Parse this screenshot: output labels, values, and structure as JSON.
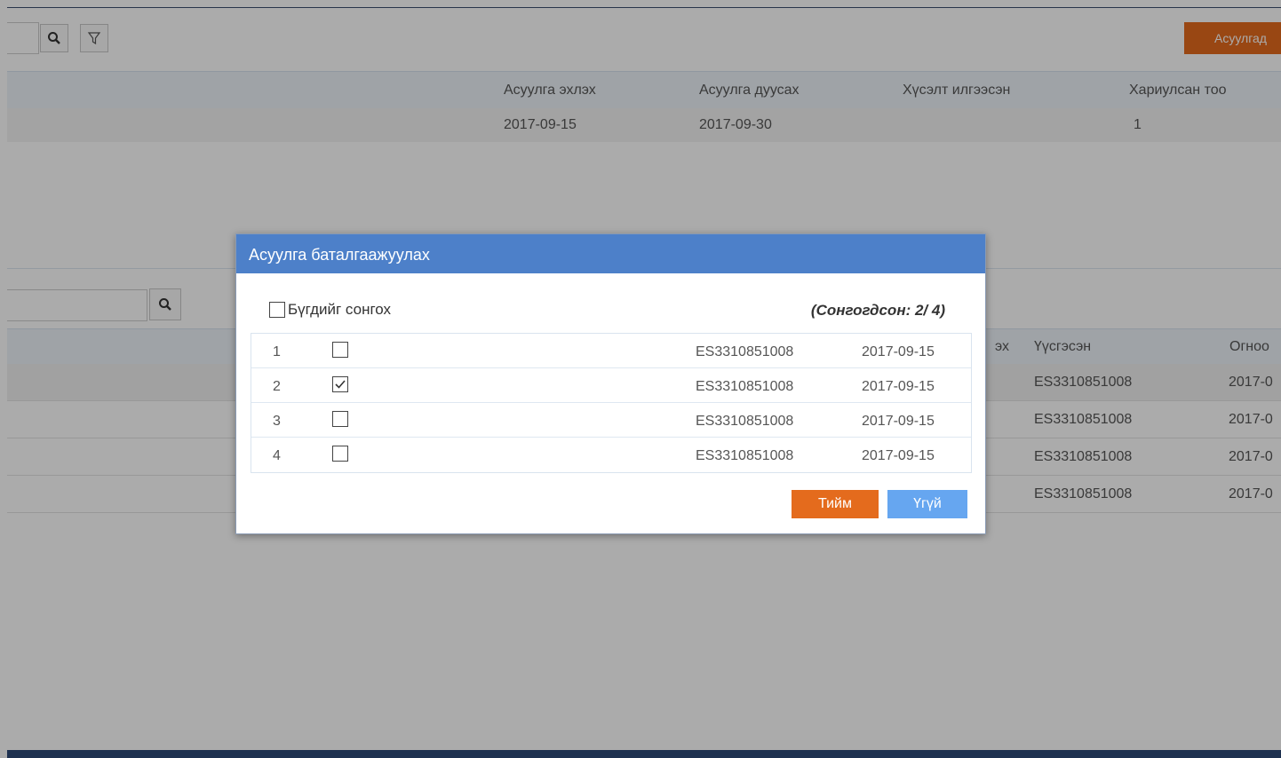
{
  "toolbar": {
    "action_button_label": "Асуулгад"
  },
  "survey_grid": {
    "columns": [
      "Асуулга эхлэх",
      "Асуулга дуусах",
      "Хүсэлт илгээсэн",
      "Хариулсан тоо"
    ],
    "row": [
      "2017-09-15",
      "2017-09-30",
      "",
      "1"
    ]
  },
  "lower_grid": {
    "columns": [
      "эх",
      "Үүсгэсэн",
      "Огноо"
    ],
    "rows": [
      {
        "creator": "ES3310851008",
        "date": "2017-0"
      },
      {
        "creator": "ES3310851008",
        "date": "2017-0"
      },
      {
        "creator": "ES3310851008",
        "date": "2017-0"
      },
      {
        "creator": "ES3310851008",
        "date": "2017-0"
      }
    ]
  },
  "modal": {
    "title": "Асуулга баталгаажуулах",
    "select_all_label": "Бүгдийг сонгох",
    "counter": "(Сонгогдсон: 2/ 4)",
    "rows": [
      {
        "num": "1",
        "checked": false,
        "code": "ES3310851008",
        "date": "2017-09-15"
      },
      {
        "num": "2",
        "checked": true,
        "code": "ES3310851008",
        "date": "2017-09-15"
      },
      {
        "num": "3",
        "checked": false,
        "code": "ES3310851008",
        "date": "2017-09-15"
      },
      {
        "num": "4",
        "checked": false,
        "code": "ES3310851008",
        "date": "2017-09-15"
      }
    ],
    "yes_label": "Тийм",
    "no_label": "Үгүй"
  },
  "colors": {
    "accent_orange": "#e46b1d",
    "header_blue": "#4d80c9",
    "button_blue": "#66a6f0"
  }
}
